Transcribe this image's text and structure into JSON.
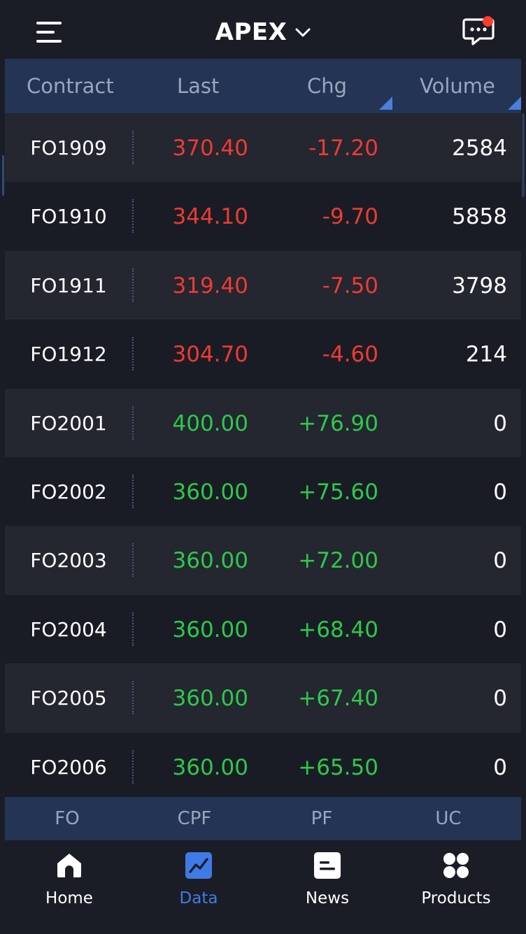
{
  "header": {
    "title": "APEX",
    "icons": {
      "menu": "hamburger-menu-icon",
      "dropdown": "chevron-down-icon",
      "messages": "chat-bubble-icon"
    },
    "notification_dot_color": "#ff3b30"
  },
  "table": {
    "columns": [
      "Contract",
      "Last",
      "Chg",
      "Volume"
    ],
    "sortable_columns": [
      "Chg",
      "Volume"
    ],
    "rows": [
      {
        "contract": "FO1909",
        "last": "370.40",
        "chg": "-17.20",
        "volume": "2584",
        "direction": "down"
      },
      {
        "contract": "FO1910",
        "last": "344.10",
        "chg": "-9.70",
        "volume": "5858",
        "direction": "down"
      },
      {
        "contract": "FO1911",
        "last": "319.40",
        "chg": "-7.50",
        "volume": "3798",
        "direction": "down"
      },
      {
        "contract": "FO1912",
        "last": "304.70",
        "chg": "-4.60",
        "volume": "214",
        "direction": "down"
      },
      {
        "contract": "FO2001",
        "last": "400.00",
        "chg": "+76.90",
        "volume": "0",
        "direction": "up"
      },
      {
        "contract": "FO2002",
        "last": "360.00",
        "chg": "+75.60",
        "volume": "0",
        "direction": "up"
      },
      {
        "contract": "FO2003",
        "last": "360.00",
        "chg": "+72.00",
        "volume": "0",
        "direction": "up"
      },
      {
        "contract": "FO2004",
        "last": "360.00",
        "chg": "+68.40",
        "volume": "0",
        "direction": "up"
      },
      {
        "contract": "FO2005",
        "last": "360.00",
        "chg": "+67.40",
        "volume": "0",
        "direction": "up"
      },
      {
        "contract": "FO2006",
        "last": "360.00",
        "chg": "+65.50",
        "volume": "0",
        "direction": "up"
      }
    ]
  },
  "sub_tabs": [
    "FO",
    "CPF",
    "PF",
    "UC"
  ],
  "bottom_nav": [
    {
      "label": "Home",
      "icon": "home-icon",
      "active": false
    },
    {
      "label": "Data",
      "icon": "chart-icon",
      "active": true
    },
    {
      "label": "News",
      "icon": "news-icon",
      "active": false
    },
    {
      "label": "Products",
      "icon": "grid-icon",
      "active": false
    }
  ],
  "colors": {
    "background": "#1b1d26",
    "header_bar": "#243455",
    "price_down": "#ee3b32",
    "price_up": "#2ec94a",
    "accent": "#3f7be6"
  }
}
